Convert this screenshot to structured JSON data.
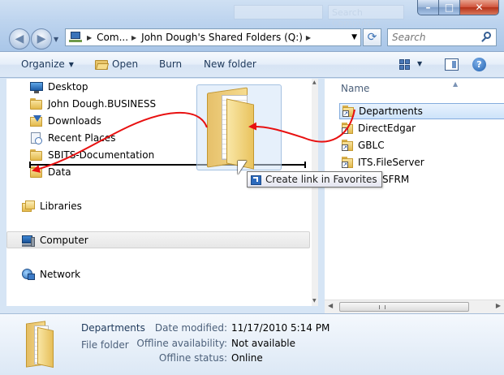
{
  "window": {
    "bg_blur_text": "Search Computer",
    "controls": {
      "minimize": "–",
      "maximize": "□",
      "close": "✕"
    }
  },
  "address": {
    "crumbs": [
      "Com...",
      "John Dough's Shared Folders (Q:)"
    ],
    "search_placeholder": "Search"
  },
  "toolbar": {
    "organize": "Organize",
    "open": "Open",
    "burn": "Burn",
    "new_folder": "New folder"
  },
  "nav": {
    "favorites": [
      {
        "label": "Desktop",
        "icon": "desktop-icon"
      },
      {
        "label": "John Dough.BUSINESS",
        "icon": "folder-icon"
      },
      {
        "label": "Downloads",
        "icon": "downloads-icon"
      },
      {
        "label": "Recent Places",
        "icon": "recent-places-icon"
      },
      {
        "label": "SBITS-Documentation",
        "icon": "folder-icon"
      },
      {
        "label": "Data",
        "icon": "folder-icon"
      }
    ],
    "libraries": "Libraries",
    "computer": "Computer",
    "network": "Network"
  },
  "files": {
    "column_name": "Name",
    "items": [
      {
        "label": "Departments",
        "selected": true
      },
      {
        "label": "DirectEdgar",
        "selected": false
      },
      {
        "label": "GBLC",
        "selected": false
      },
      {
        "label": "ITS.FileServer",
        "selected": false
      },
      {
        "label": "wwMSFRM",
        "selected": false
      }
    ]
  },
  "drag": {
    "tooltip": "Create link in Favorites"
  },
  "details": {
    "name": "Departments",
    "type": "File folder",
    "date_modified_label": "Date modified:",
    "date_modified_value": "11/17/2010 5:14 PM",
    "offline_availability_label": "Offline availability:",
    "offline_availability_value": "Not available",
    "offline_status_label": "Offline status:",
    "offline_status_value": "Online"
  },
  "colors": {
    "annotation_arrow": "#e81010",
    "selection": "#cde3fa",
    "chrome": "#bcd3ee"
  }
}
